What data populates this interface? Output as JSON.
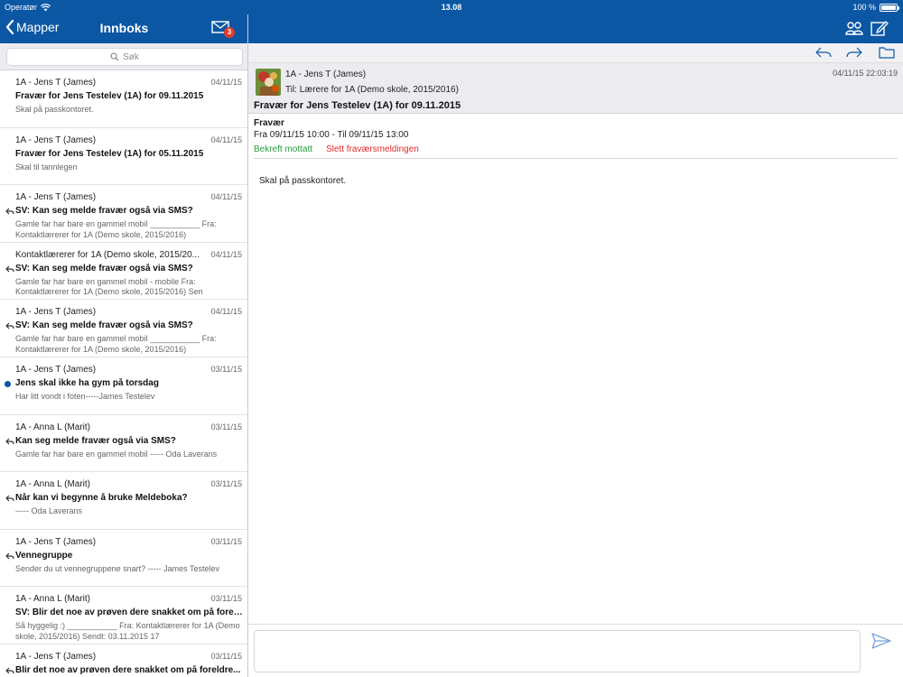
{
  "status": {
    "carrier": "Operatør",
    "time": "13.08",
    "battery": "100 %"
  },
  "left_nav": {
    "back_label": "Mapper",
    "title": "Innboks",
    "unread_badge": "3"
  },
  "search": {
    "placeholder": "Søk"
  },
  "messages": [
    {
      "from": "1A - Jens T (James)",
      "date": "04/11/15",
      "subject": "Fravær for Jens Testelev (1A) for 09.11.2015",
      "preview": "Skal på passkontoret.",
      "replied": false,
      "unread": false
    },
    {
      "from": "1A - Jens T (James)",
      "date": "04/11/15",
      "subject": "Fravær for Jens Testelev (1A) for 05.11.2015",
      "preview": "Skal til tannlegen",
      "replied": false,
      "unread": false
    },
    {
      "from": "1A - Jens T (James)",
      "date": "04/11/15",
      "subject": "SV: Kan seg melde fravær også via SMS?",
      "preview": "Gamle far har bare en gammel mobil ___________ Fra: Kontaktlærerer for 1A (Demo skole, 2015/2016)",
      "replied": true,
      "unread": false
    },
    {
      "from": "Kontaktlærerer for 1A (Demo skole, 2015/20...",
      "date": "04/11/15",
      "subject": "SV: Kan seg melde fravær også via SMS?",
      "preview": "Gamle far har bare en gammel mobil - mobile   Fra: Kontaktlærerer for 1A (Demo skole, 2015/2016) Sen",
      "replied": true,
      "unread": false
    },
    {
      "from": "1A - Jens T (James)",
      "date": "04/11/15",
      "subject": "SV: Kan seg melde fravær også via SMS?",
      "preview": "Gamle far har bare en gammel mobil ___________ Fra: Kontaktlærerer for 1A (Demo skole, 2015/2016)",
      "replied": true,
      "unread": false
    },
    {
      "from": "1A - Jens T (James)",
      "date": "03/11/15",
      "subject": "Jens skal ikke ha gym på torsdag",
      "preview": "Har litt vondt i foten-----James Testelev",
      "replied": false,
      "unread": true
    },
    {
      "from": "1A - Anna L (Marit)",
      "date": "03/11/15",
      "subject": "Kan seg melde fravær også via SMS?",
      "preview": "Gamle far har bare en gammel mobil ----- Oda Laverans",
      "replied": true,
      "unread": false
    },
    {
      "from": "1A - Anna L (Marit)",
      "date": "03/11/15",
      "subject": "Når kan vi begynne å bruke Meldeboka?",
      "preview": "----- Oda Laverans",
      "replied": true,
      "unread": false
    },
    {
      "from": "1A - Jens T (James)",
      "date": "03/11/15",
      "subject": "Vennegruppe",
      "preview": "Sender du ut vennegruppene snart? ----- James Testelev",
      "replied": true,
      "unread": false
    },
    {
      "from": "1A - Anna L (Marit)",
      "date": "03/11/15",
      "subject": "SV: Blir det noe av prøven dere snakket om på forel...",
      "preview": "Så hyggelig :) ___________ Fra: Kontaktlærerer for 1A (Demo skole, 2015/2016) Sendt: 03.11.2015 17",
      "replied": false,
      "unread": false
    },
    {
      "from": "1A - Jens T (James)",
      "date": "03/11/15",
      "subject": "Blir det noe av prøven dere snakket om på foreldre...",
      "preview": "",
      "replied": true,
      "unread": false
    }
  ],
  "detail": {
    "sender": "1A - Jens T (James)",
    "to": "Til: Lærere for 1A (Demo skole, 2015/2016)",
    "datetime": "04/11/15 22:03:19",
    "subject": "Fravær for Jens Testelev (1A) for 09.11.2015",
    "absence_type": "Fravær",
    "absence_range": "Fra 09/11/15 10:00 - Til 09/11/15 13:00",
    "confirm_label": "Bekreft mottatt",
    "delete_label": "Slett fraværsmeldingen",
    "body": "Skal på passkontoret."
  },
  "colors": {
    "header_blue": "#0b57a4",
    "confirm_green": "#2a9d3e",
    "delete_red": "#e0282b",
    "badge_red": "#e23a2b"
  },
  "icons": [
    "wifi-icon",
    "chevron-left-icon",
    "mail-icon",
    "search-icon",
    "group-icon",
    "compose-icon",
    "reply-icon",
    "forward-icon",
    "folder-icon",
    "send-icon"
  ]
}
